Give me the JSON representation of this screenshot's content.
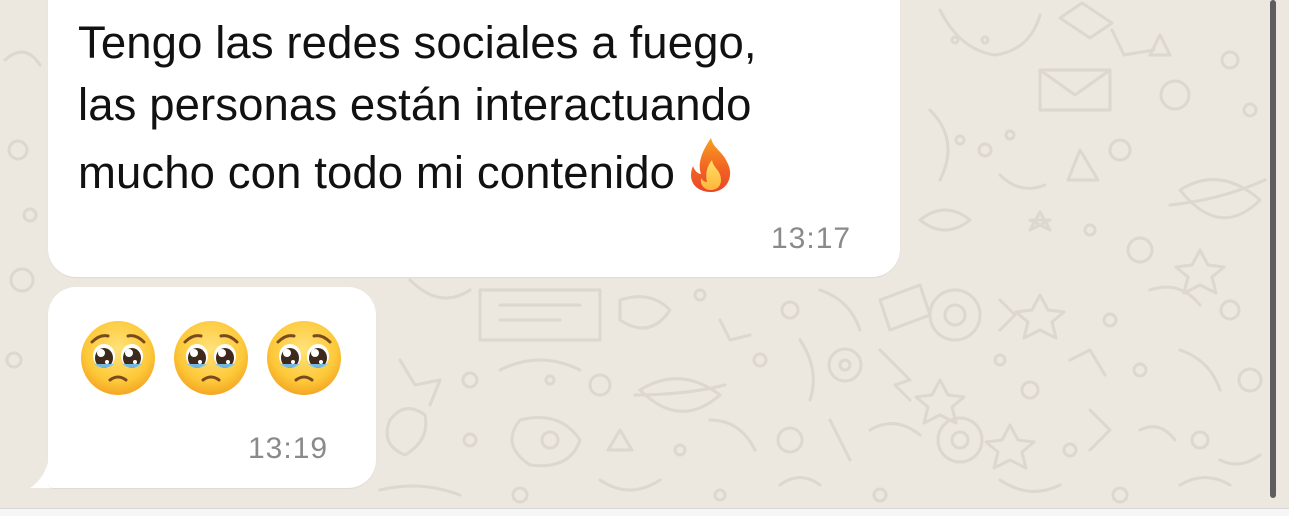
{
  "colors": {
    "chat_background": "#ECE7DF",
    "bubble_background": "#FFFFFF",
    "message_text": "#111111",
    "timestamp_text": "#8A8A8A"
  },
  "messages": [
    {
      "lines": [
        "Tengo las redes sociales a fuego,",
        "las personas están interactuando",
        "mucho con todo mi contenido"
      ],
      "trailing_icon": "fire-emoji",
      "time": "13:17"
    },
    {
      "emojis": [
        "pleading-face-emoji",
        "pleading-face-emoji",
        "pleading-face-emoji"
      ],
      "time": "13:19"
    }
  ]
}
